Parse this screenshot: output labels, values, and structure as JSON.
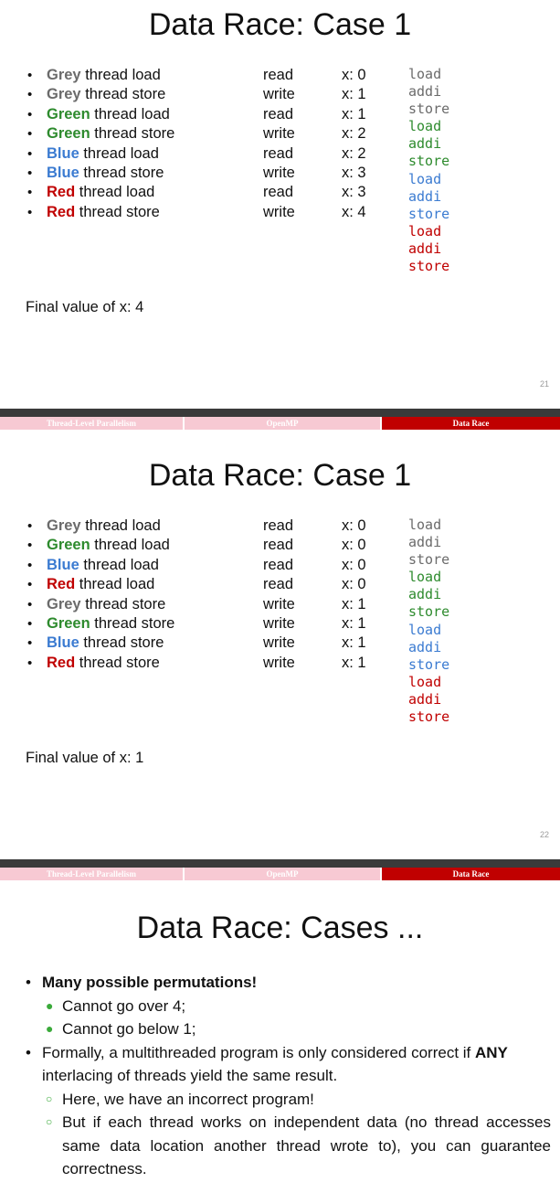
{
  "slide1": {
    "title": "Data Race: Case 1",
    "rows": [
      {
        "color": "Grey",
        "rest": " thread load",
        "op": "read",
        "val": "x: 0"
      },
      {
        "color": "Grey",
        "rest": " thread store",
        "op": "write",
        "val": "x: 1"
      },
      {
        "color": "Green",
        "rest": " thread load",
        "op": "read",
        "val": "x: 1"
      },
      {
        "color": "Green",
        "rest": " thread store",
        "op": "write",
        "val": "x: 2"
      },
      {
        "color": "Blue",
        "rest": " thread load",
        "op": "read",
        "val": "x: 2"
      },
      {
        "color": "Blue",
        "rest": " thread store",
        "op": "write",
        "val": "x: 3"
      },
      {
        "color": "Red",
        "rest": " thread load",
        "op": "read",
        "val": "x: 3"
      },
      {
        "color": "Red",
        "rest": " thread store",
        "op": "write",
        "val": "x: 4"
      }
    ],
    "code": [
      "load",
      "addi",
      "store",
      "load",
      "addi",
      "store",
      "load",
      "addi",
      "store",
      "load",
      "addi",
      "store"
    ],
    "final": "Final value of x: 4",
    "page_number": "21"
  },
  "slide2": {
    "title": "Data Race: Case 1",
    "rows": [
      {
        "color": "Grey",
        "rest": " thread load",
        "op": "read",
        "val": "x: 0"
      },
      {
        "color": "Green",
        "rest": " thread load",
        "op": "read",
        "val": "x: 0"
      },
      {
        "color": "Blue",
        "rest": " thread load",
        "op": "read",
        "val": "x: 0"
      },
      {
        "color": "Red",
        "rest": " thread load",
        "op": "read",
        "val": "x: 0"
      },
      {
        "color": "Grey",
        "rest": " thread store",
        "op": "write",
        "val": "x: 1"
      },
      {
        "color": "Green",
        "rest": " thread store",
        "op": "write",
        "val": "x: 1"
      },
      {
        "color": "Blue",
        "rest": " thread store",
        "op": "write",
        "val": "x: 1"
      },
      {
        "color": "Red",
        "rest": " thread store",
        "op": "write",
        "val": "x: 1"
      }
    ],
    "code": [
      "load",
      "addi",
      "store",
      "load",
      "addi",
      "store",
      "load",
      "addi",
      "store",
      "load",
      "addi",
      "store"
    ],
    "final": "Final value of x: 1",
    "page_number": "22"
  },
  "navbar": {
    "section1": "Thread-Level Parallelism",
    "section2": "OpenMP",
    "section3": "Data Race"
  },
  "slide3": {
    "title": "Data Race: Cases ...",
    "b1": "Many possible permutations!",
    "b1_sub1": "Cannot go over 4;",
    "b1_sub2": "Cannot go below 1;",
    "b2_pre": "Formally, a multithreaded program is only considered correct if ",
    "b2_bold": "ANY",
    "b2_post": " interlacing of threads yield the same result.",
    "b2_sub1": "Here, we have an incorrect program!",
    "b2_sub2": "But if each thread works on independent data (no thread accesses same data location another thread wrote to), you can guarantee correctness."
  },
  "colors": {
    "grey": "#6b6b6b",
    "green": "#2e8b2e",
    "blue": "#3b7bd1",
    "red": "#c00000",
    "nav_dark": "#3a3a3a",
    "nav_pink": "#f7c9d3",
    "nav_active": "#c00000"
  }
}
